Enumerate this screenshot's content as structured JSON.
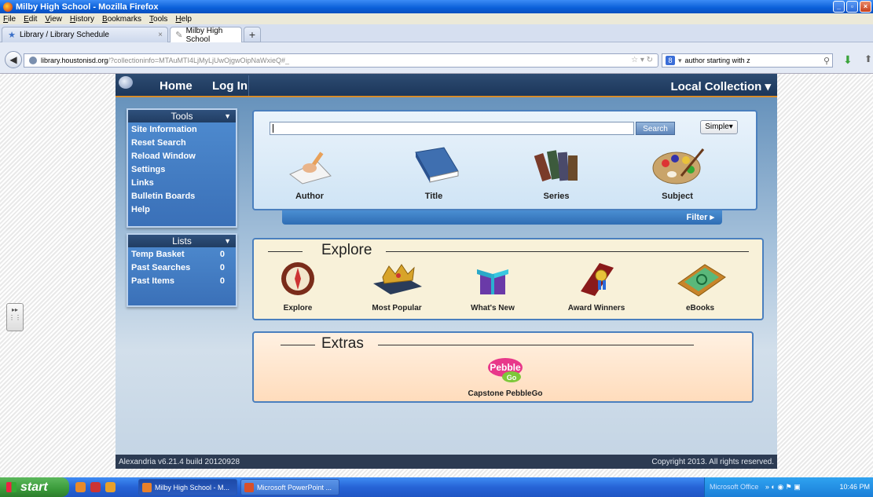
{
  "window": {
    "title": "Milby High School - Mozilla Firefox",
    "menu": [
      "File",
      "Edit",
      "View",
      "History",
      "Bookmarks",
      "Tools",
      "Help"
    ]
  },
  "tabs": [
    {
      "label": "Library / Library Schedule"
    },
    {
      "label": "Milby High School"
    }
  ],
  "nav": {
    "url_domain": "library.houstonisd.org",
    "url_rest": "/?collectioninfo=MTAuMTI4LjMyLjUwOjgwOipNaWxieQ#_",
    "search_value": "author starting with z"
  },
  "app": {
    "nav_home": "Home",
    "nav_login": "Log In",
    "collection": "Local Collection",
    "tools_header": "Tools",
    "tools": [
      "Site Information",
      "Reset Search",
      "Reload Window",
      "Settings",
      "Links",
      "Bulletin Boards",
      "Help"
    ],
    "lists_header": "Lists",
    "lists": [
      {
        "label": "Temp Basket",
        "count": "0"
      },
      {
        "label": "Past Searches",
        "count": "0"
      },
      {
        "label": "Past Items",
        "count": "0"
      }
    ],
    "search_button": "Search",
    "search_mode": "Simple",
    "categories": [
      "Author",
      "Title",
      "Series",
      "Subject"
    ],
    "filter": "Filter",
    "explore_heading": "Explore",
    "explore_items": [
      "Explore",
      "Most Popular",
      "What's New",
      "Award Winners",
      "eBooks"
    ],
    "extras_heading": "Extras",
    "extras_items": [
      "Capstone PebbleGo"
    ],
    "pebble_logo_top": "Pebble",
    "pebble_logo_bottom": "Go",
    "footer_version": "Alexandria v6.21.4 build 20120928",
    "footer_copyright": "Copyright 2013. All rights reserved."
  },
  "taskbar": {
    "start": "start",
    "buttons": [
      "Milby High School - M...",
      "Microsoft PowerPoint ..."
    ],
    "tray_text": "Microsoft Office",
    "clock": "10:46 PM"
  }
}
